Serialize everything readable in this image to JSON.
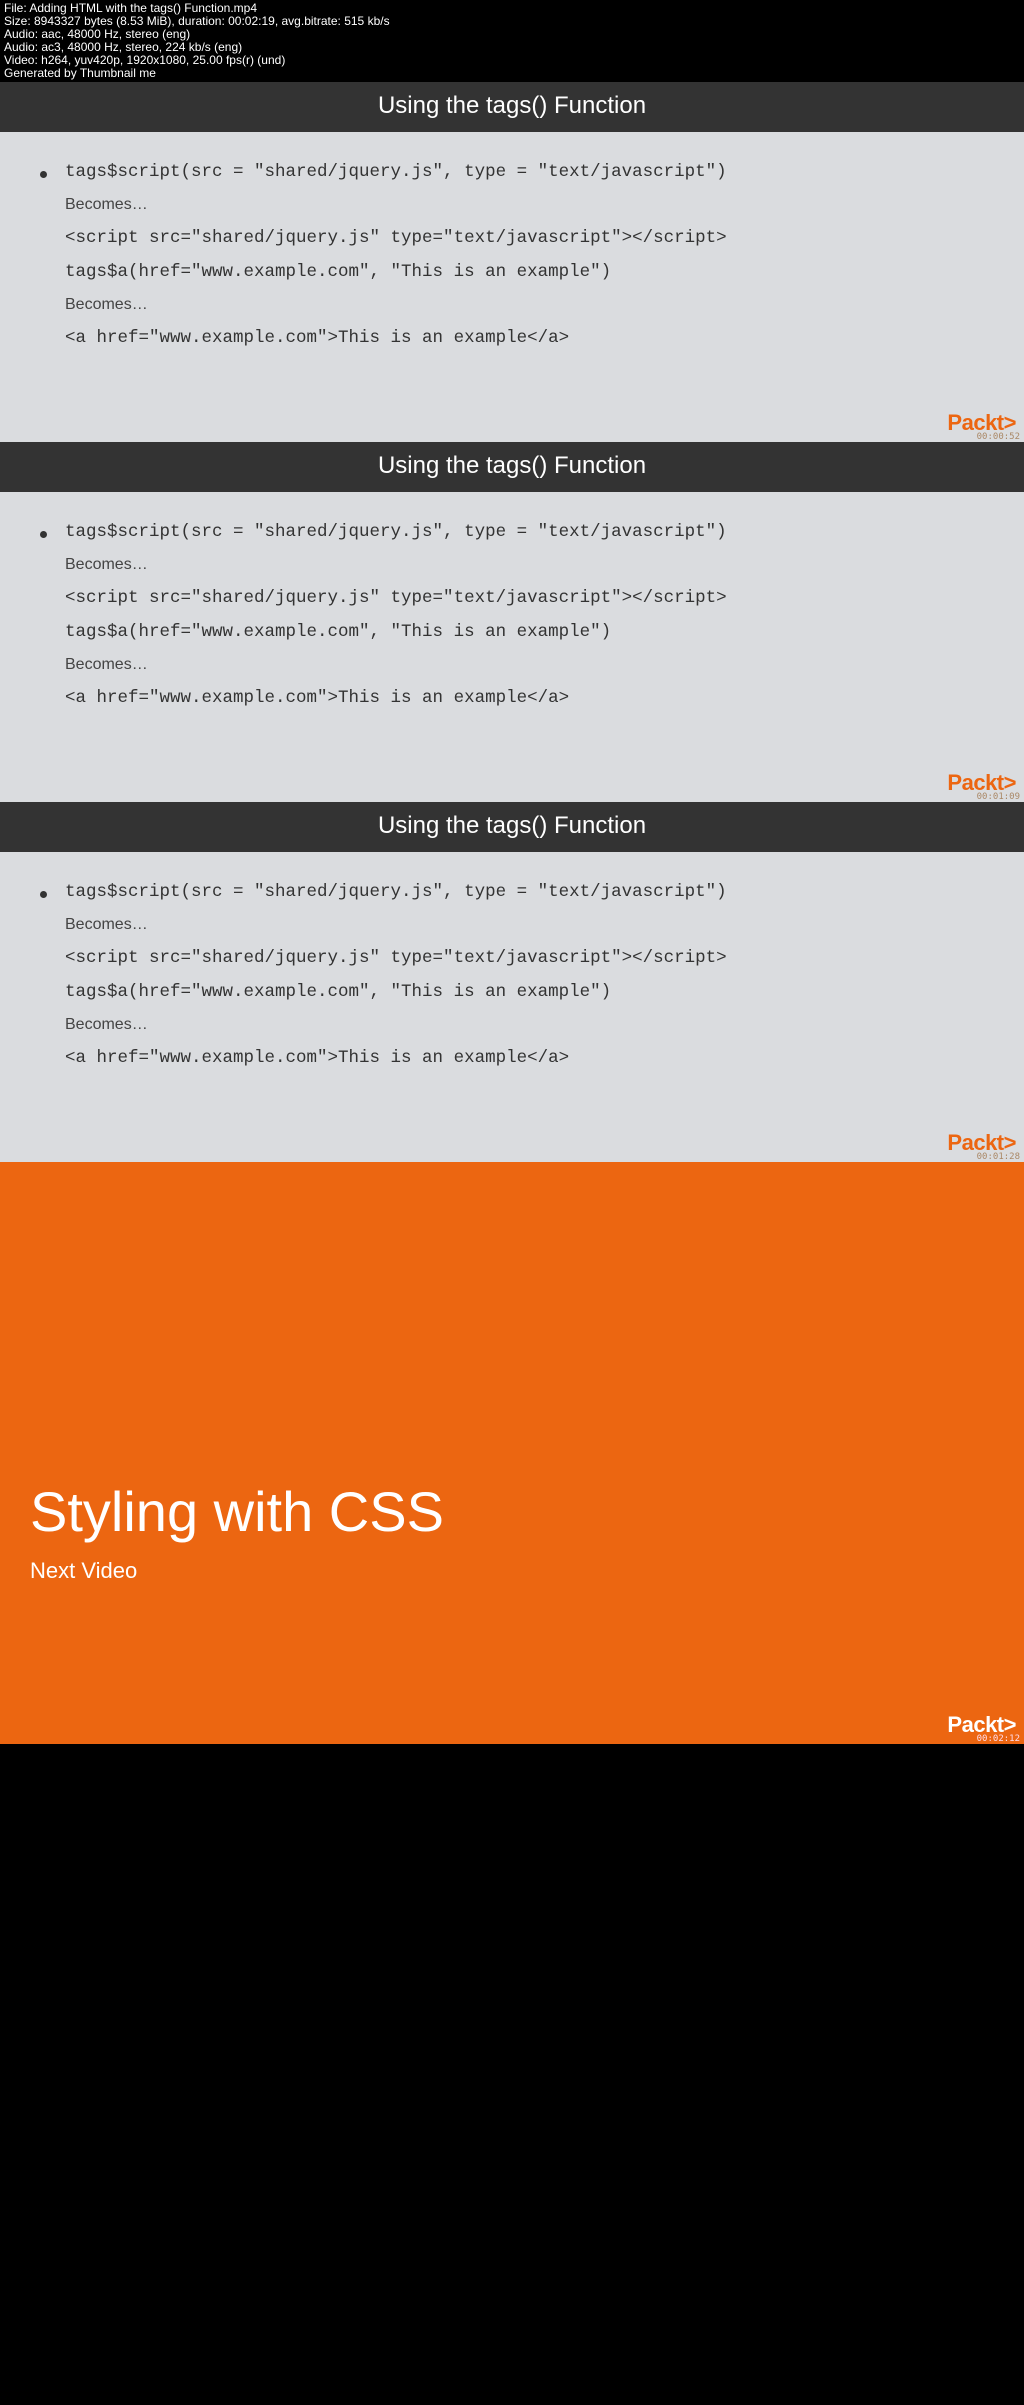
{
  "fileinfo": {
    "l1": "File: Adding HTML with the tags() Function.mp4",
    "l2": "Size: 8943327 bytes (8.53 MiB), duration: 00:02:19, avg.bitrate: 515 kb/s",
    "l3": "Audio: aac, 48000 Hz, stereo (eng)",
    "l4": "Audio: ac3, 48000 Hz, stereo, 224 kb/s (eng)",
    "l5": "Video: h264, yuv420p, 1920x1080, 25.00 fps(r) (und)",
    "l6": "Generated by Thumbnail me"
  },
  "slide": {
    "title": "Using the tags() Function",
    "c1": "tags$script(src = \"shared/jquery.js\", type = \"text/javascript\")",
    "b1": "Becomes…",
    "c2": "<script src=\"shared/jquery.js\" type=\"text/javascript\"></script>",
    "c3": "tags$a(href=\"www.example.com\", \"This is an example\")",
    "b2": "Becomes…",
    "c4": "<a href=\"www.example.com\">This is an example</a>"
  },
  "brand": "Packt",
  "brand_gt": ">",
  "ts": {
    "t1": "00:00:52",
    "t2": "00:01:09",
    "t3": "00:01:28",
    "t4": "00:02:12"
  },
  "orange": {
    "title": "Styling with CSS",
    "sub": "Next Video"
  }
}
